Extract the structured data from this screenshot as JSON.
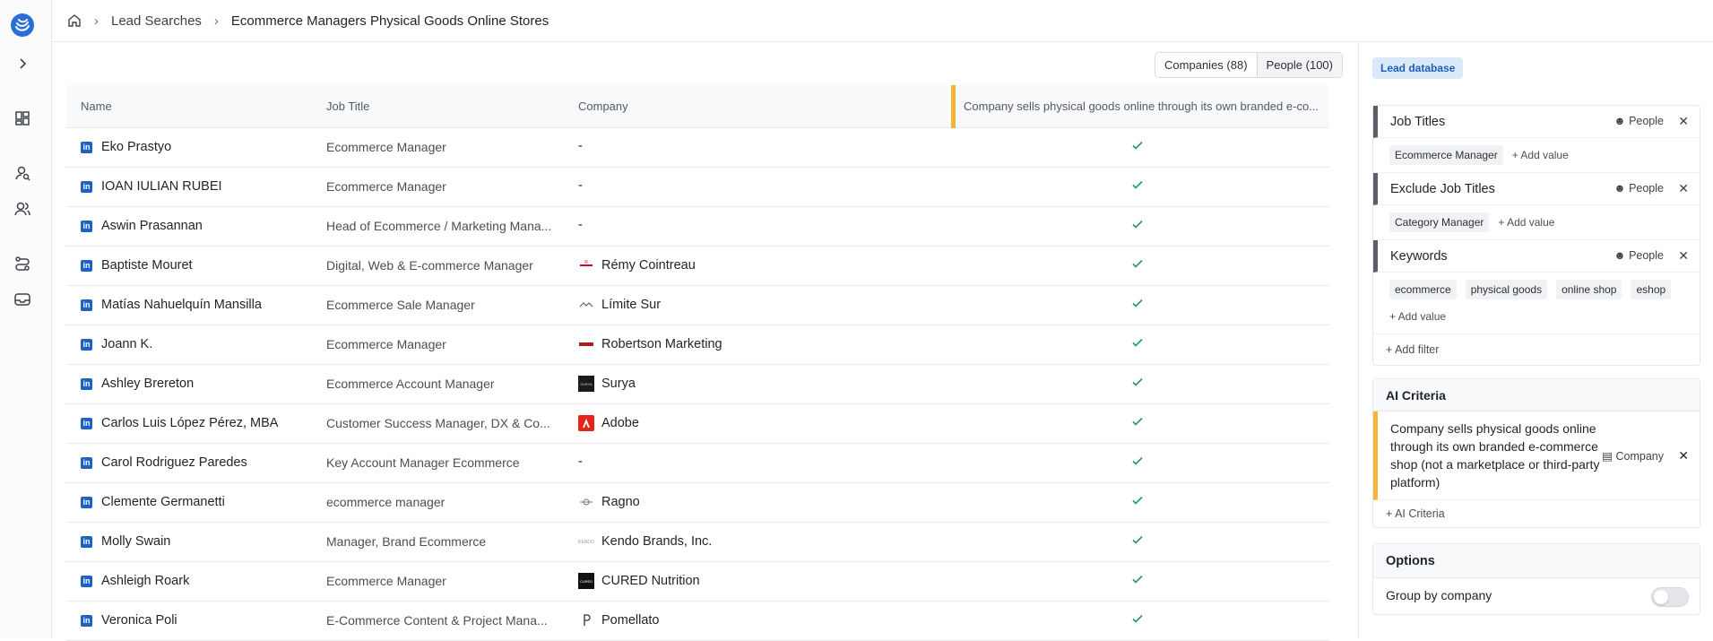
{
  "breadcrumb": {
    "parent": "Lead Searches",
    "current": "Ecommerce Managers Physical Goods Online Stores"
  },
  "view_toggle": {
    "companies": "Companies (88)",
    "people": "People (100)"
  },
  "table": {
    "headers": {
      "name": "Name",
      "job": "Job Title",
      "company": "Company",
      "ai": "Company sells physical goods online through its own branded e-co..."
    },
    "rows": [
      {
        "name": "Eko Prastyo",
        "job": "Ecommerce Manager",
        "company": "-",
        "logo": ""
      },
      {
        "name": "IOAN IULIAN RUBEI",
        "job": "Ecommerce Manager",
        "company": "-",
        "logo": ""
      },
      {
        "name": "Aswin Prasannan",
        "job": "Head of Ecommerce / Marketing Mana...",
        "company": "-",
        "logo": ""
      },
      {
        "name": "Baptiste Mouret",
        "job": "Digital, Web & E-commerce Manager",
        "company": "Rémy Cointreau",
        "logo": "remy"
      },
      {
        "name": "Matías Nahuelquín Mansilla",
        "job": "Ecommerce Sale Manager",
        "company": "Límite Sur",
        "logo": "limite"
      },
      {
        "name": "Joann K.",
        "job": "Ecommerce Manager",
        "company": "Robertson Marketing",
        "logo": "robertson"
      },
      {
        "name": "Ashley Brereton",
        "job": "Ecommerce Account Manager",
        "company": "Surya",
        "logo": "surya"
      },
      {
        "name": "Carlos Luis López Pérez, MBA",
        "job": "Customer Success Manager, DX & Co...",
        "company": "Adobe",
        "logo": "adobe"
      },
      {
        "name": "Carol Rodriguez Paredes",
        "job": "Key Account Manager Ecommerce",
        "company": "-",
        "logo": ""
      },
      {
        "name": "Clemente Germanetti",
        "job": "ecommerce manager",
        "company": "Ragno",
        "logo": "ragno"
      },
      {
        "name": "Molly Swain",
        "job": "Manager, Brand Ecommerce",
        "company": "Kendo Brands, Inc.",
        "logo": "kendo"
      },
      {
        "name": "Ashleigh Roark",
        "job": "Ecommerce Manager",
        "company": "CURED Nutrition",
        "logo": "cured"
      },
      {
        "name": "Veronica Poli",
        "job": "E-Commerce Content & Project Mana...",
        "company": "Pomellato",
        "logo": "pomellato"
      }
    ]
  },
  "panel": {
    "db_badge": "Lead database",
    "filters": [
      {
        "label": "Job Titles",
        "scope": "People",
        "values": [
          "Ecommerce Manager"
        ],
        "add": "+ Add value"
      },
      {
        "label": "Exclude Job Titles",
        "scope": "People",
        "values": [
          "Category Manager"
        ],
        "add": "+ Add value"
      },
      {
        "label": "Keywords",
        "scope": "People",
        "values": [
          "ecommerce",
          "physical goods",
          "online shop",
          "eshop"
        ],
        "add": "+ Add value"
      }
    ],
    "add_filter": "+ Add filter",
    "ai_title": "AI Criteria",
    "ai_criterion": "Company sells physical goods online through its own branded e-commerce shop (not a marketplace or third-party platform)",
    "ai_scope": "Company",
    "ai_add": "+ AI Criteria",
    "options_title": "Options",
    "group_by": "Group by company"
  },
  "colors": {
    "accent_yellow": "#f2b538",
    "linkedin_blue": "#1d63c7",
    "check_green": "#1f9c57"
  }
}
